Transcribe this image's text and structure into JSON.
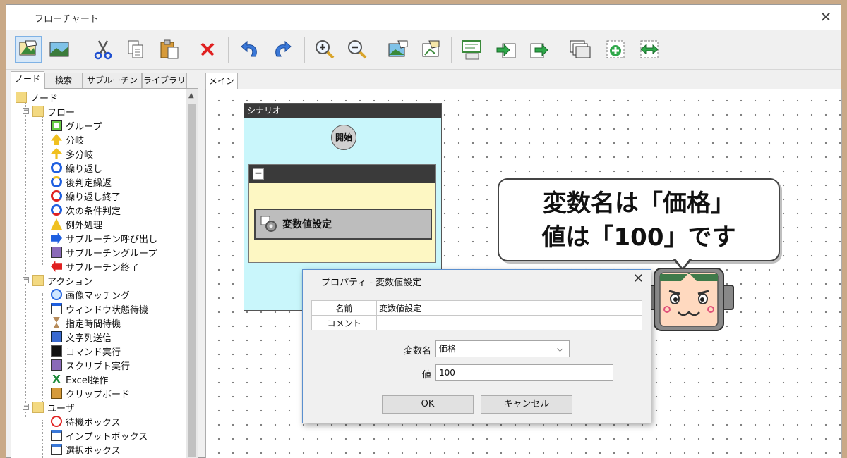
{
  "window": {
    "title": "フローチャート",
    "close_icon": "close-icon"
  },
  "toolbar": {
    "icons": [
      "node-view-icon",
      "image-view-icon",
      "cut-icon",
      "copy-icon",
      "paste-icon",
      "delete-icon",
      "undo-icon",
      "redo-icon",
      "zoom-in-icon",
      "zoom-out-icon",
      "image-node-icon",
      "image-edit-icon",
      "comment-icon",
      "import-icon",
      "export-icon",
      "window-icon",
      "add-node-icon",
      "swap-icon"
    ]
  },
  "left_tabs": [
    "ノード",
    "検索",
    "サブルーチン",
    "ライブラリ"
  ],
  "tree": {
    "root": "ノード",
    "groups": [
      {
        "label": "フロー",
        "items": [
          "グループ",
          "分岐",
          "多分岐",
          "繰り返し",
          "後判定繰返",
          "繰り返し終了",
          "次の条件判定",
          "例外処理",
          "サブルーチン呼び出し",
          "サブルーチングループ",
          "サブルーチン終了"
        ]
      },
      {
        "label": "アクション",
        "items": [
          "画像マッチング",
          "ウィンドウ状態待機",
          "指定時間待機",
          "文字列送信",
          "コマンド実行",
          "スクリプト実行",
          "Excel操作",
          "クリップボード"
        ]
      },
      {
        "label": "ユーザ",
        "items": [
          "待機ボックス",
          "インプットボックス",
          "選択ボックス"
        ]
      }
    ]
  },
  "main_tab": "メイン",
  "flowchart": {
    "scenario_label": "シナリオ",
    "start_label": "開始",
    "group_toggle": "−",
    "node_label": "変数値設定"
  },
  "dialog": {
    "title": "プロパティ - 変数値設定",
    "table": {
      "name_label": "名前",
      "name_value": "変数値設定",
      "comment_label": "コメント",
      "comment_value": ""
    },
    "var_label": "変数名",
    "var_value": "価格",
    "value_label": "値",
    "value_value": "100",
    "ok_label": "OK",
    "cancel_label": "キャンセル"
  },
  "bubble": {
    "line1": "変数名は「価格」",
    "line2": "値は「100」です"
  },
  "colors": {
    "accent": "#5a8fcf",
    "scenario_bg": "#c9f6fb",
    "group_bg": "#fdf7c3",
    "node_bg": "#bdbdbd"
  }
}
